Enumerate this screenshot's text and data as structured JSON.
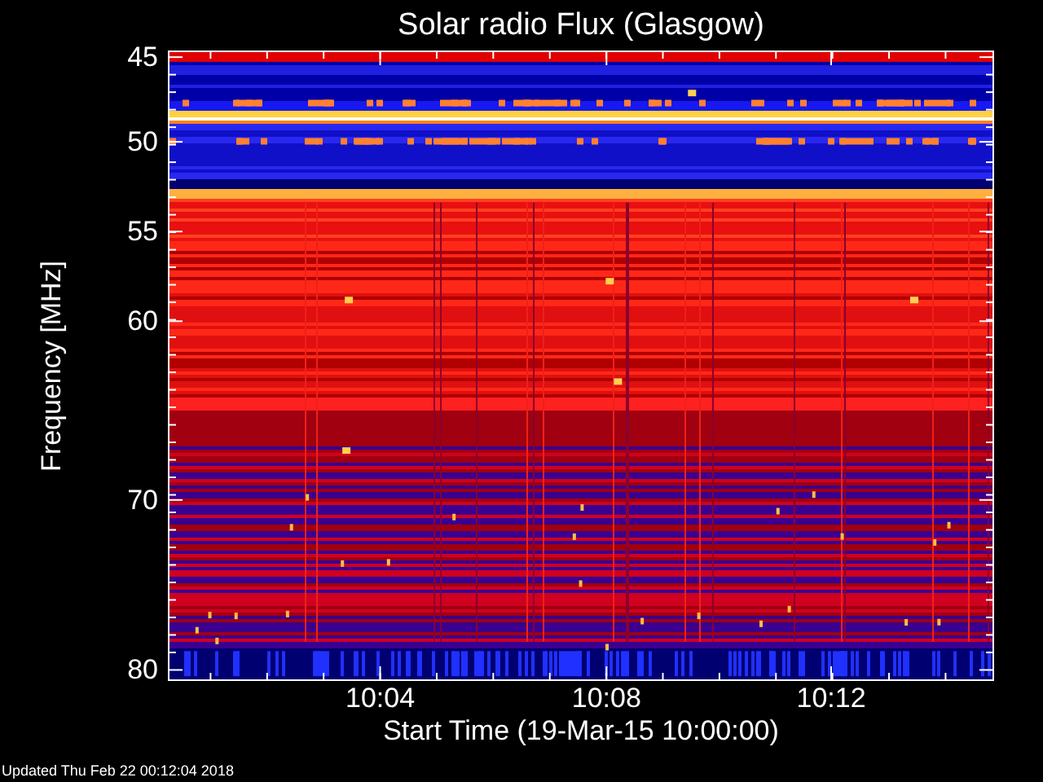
{
  "title": "Solar radio Flux (Glasgow)",
  "y_axis": {
    "label": "Frequency [MHz]",
    "ticks": [
      "45",
      "50",
      "55",
      "60",
      "70",
      "80"
    ]
  },
  "x_axis": {
    "label": "Start Time (19-Mar-15 10:00:00)",
    "ticks": [
      "10:04",
      "10:08",
      "10:12"
    ]
  },
  "footer": "Updated Thu Feb 22 00:12:04 2018"
}
